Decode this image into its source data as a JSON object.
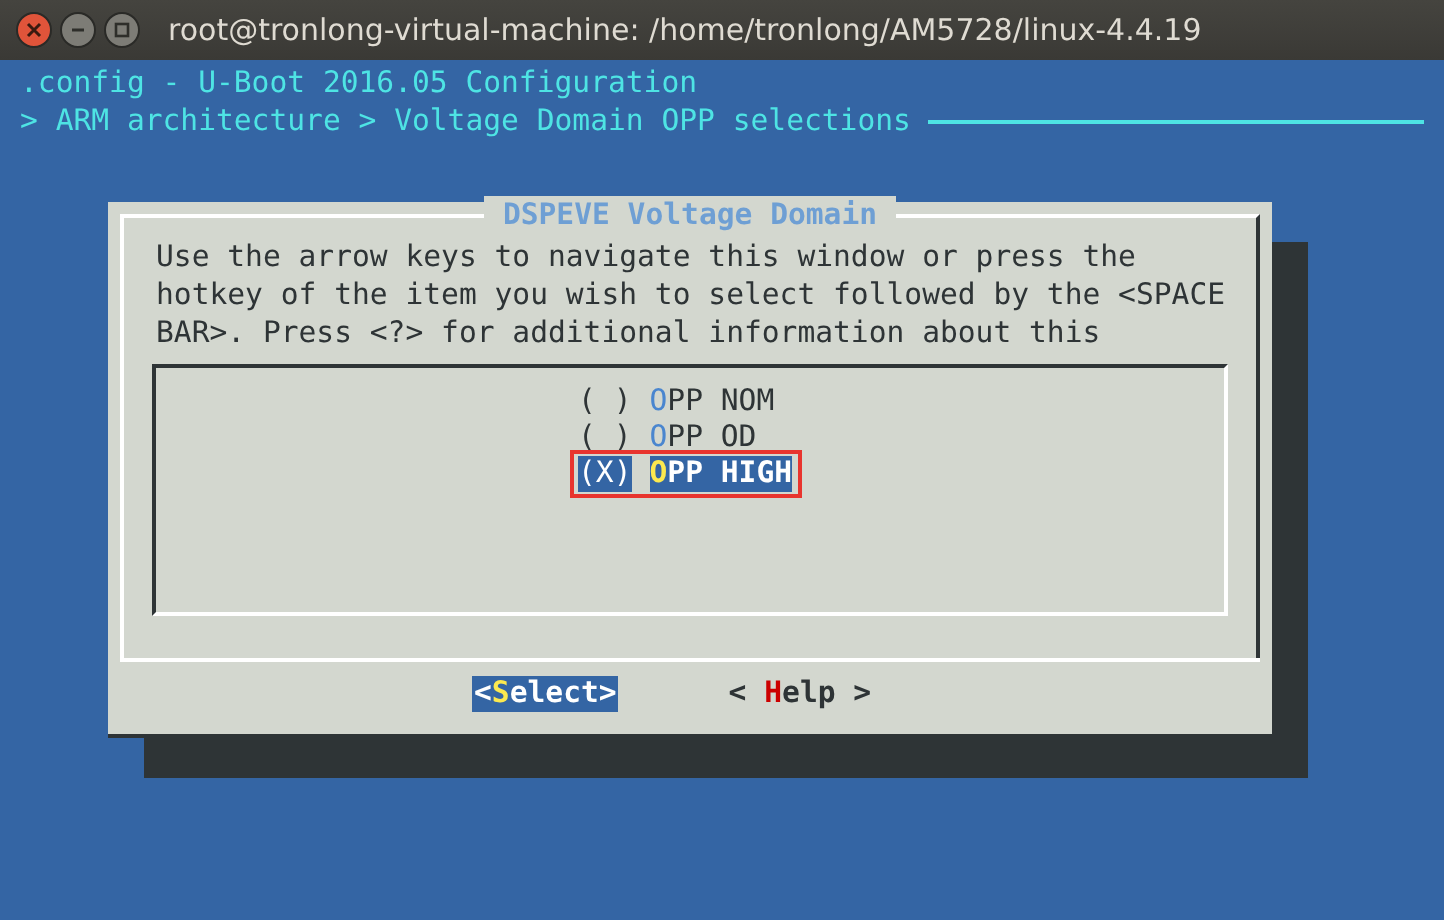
{
  "window": {
    "title": "root@tronlong-virtual-machine: /home/tronlong/AM5728/linux-4.4.19"
  },
  "header": {
    "config": ".config - U-Boot 2016.05 Configuration",
    "breadcrumb": "> ARM architecture > Voltage Domain OPP selections"
  },
  "dialog": {
    "title": "DSPEVE Voltage Domain",
    "help_text": [
      "Use the arrow keys to navigate this window or press the",
      "hotkey of the item you wish to select followed by the <SPACE",
      "BAR>. Press <?> for additional information about this"
    ],
    "items": [
      {
        "mark": "( )",
        "label": "OPP NOM",
        "selected": false,
        "highlighted": false
      },
      {
        "mark": "( )",
        "label": "OPP OD",
        "selected": false,
        "highlighted": false
      },
      {
        "mark": "(X)",
        "label": "OPP HIGH",
        "selected": true,
        "highlighted": true
      }
    ],
    "buttons": [
      {
        "label": "<Select>",
        "selected": true,
        "color": "#fce94f"
      },
      {
        "label": "< Help >",
        "selected": false,
        "color": "#cc0000"
      }
    ]
  }
}
